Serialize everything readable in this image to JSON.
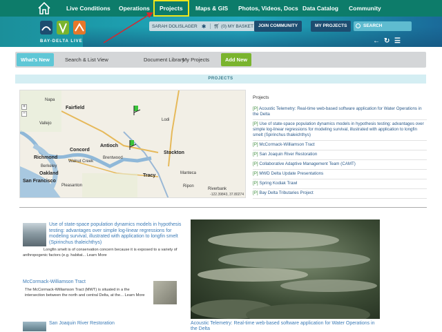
{
  "topnav": {
    "items": [
      "Live Conditions",
      "Operations",
      "Projects",
      "Maps & GIS",
      "Photos, Videos, Docs",
      "Data Catalog",
      "Community"
    ],
    "active": "Projects"
  },
  "brand": {
    "logo_text": "BAY-DELTA LIVE"
  },
  "user": {
    "name": "SARAH DOLISLAGER",
    "basket": "(0) MY BASKET"
  },
  "buttons": {
    "join": "JOIN COMMUNITY",
    "my_projects": "MY PROJECTS"
  },
  "search": {
    "placeholder": "SEARCH"
  },
  "subnav": {
    "items": [
      "What's New",
      "Search & List View",
      "Document Library",
      "My Projects",
      "Add New"
    ],
    "active": "What's New"
  },
  "section": {
    "title": "PROJECTS"
  },
  "map": {
    "coords": "-122.39843, 37.80274",
    "labels": [
      "Fairfield",
      "Napa",
      "Vallejo",
      "Concord",
      "Antioch",
      "Richmond",
      "Berkeley",
      "Oakland",
      "San Francisco",
      "Stockton",
      "Lodi",
      "Brentwood",
      "Tracy",
      "Manteca",
      "Ripon",
      "Walnut Creek",
      "Pleasanton",
      "Riverbank"
    ],
    "marker_color": "#3ac43a"
  },
  "projects": {
    "heading": "Projects",
    "items": [
      "Acoustic Telemetry: Real-time web-based software application for Water Operations in the Delta",
      "Use of state-space population dynamics models in hypothesis testing: advantages over simple log-linear regressions for modeling survival, illustrated with application to longfin smelt (Spirinchus thaleichthys)",
      "McCormack-Williamson Tract",
      "San Joaquin River Restoration",
      "Collaborative Adaptive Management Team (CAMT)",
      "MWD Delta Update Presentations",
      "Spring Kodiak Trawl",
      "Bay Delta Tributaries Project"
    ],
    "tag": "[P]"
  },
  "articles": [
    {
      "title": "Use of state-space population dynamics models in hypothesis testing: advantages over simple log-linear regressions for modeling survival, illustrated with application to longfin smelt (Spirinchus thaleichthys)",
      "body": "Longfin smelt is of conservation concern because it is exposed to a variety of anthropogenic factors (e.g. habitat... Learn More"
    },
    {
      "title": "McCormack-Williamson Tract",
      "body": "The McCormack-Williamson Tract (MWT) is situated in a the intersection between the north and central Delta, at the... Learn More"
    },
    {
      "title": "San Joaquin River Restoration",
      "body": ""
    }
  ],
  "feature": {
    "caption": "Acoustic Telemetry: Real-time web-based software application for Water Operations in the Delta"
  },
  "colors": {
    "nav_bg": "#0d7c6a",
    "active_outline": "#f0e61a",
    "link": "#3a7ab6",
    "tab_active": "#5fc7d6",
    "add_new": "#7ab42e"
  }
}
